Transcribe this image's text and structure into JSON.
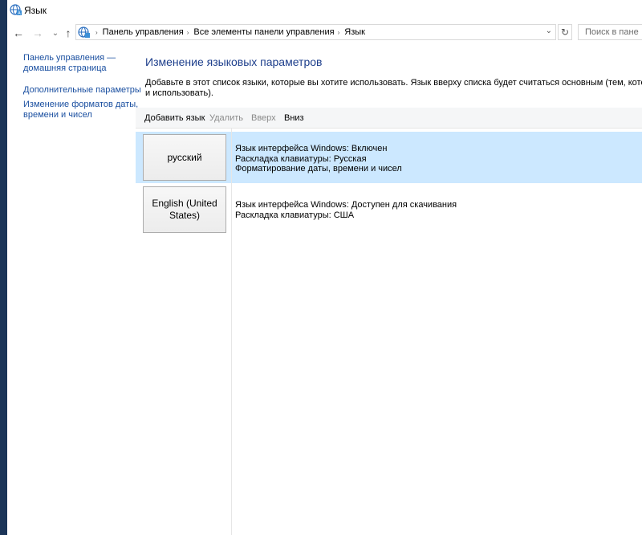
{
  "window": {
    "title": "Язык"
  },
  "nav": {
    "back": "←",
    "forward": "→",
    "recent": "⌄",
    "up": "↑",
    "breadcrumbs": [
      "Панель управления",
      "Все элементы панели управления",
      "Язык"
    ],
    "breadcrumb_sep": "›",
    "dropdown": "⌄",
    "refresh": "↻",
    "search_placeholder": "Поиск в пане"
  },
  "sidebar": {
    "home_line1": "Панель управления —",
    "home_line2": "домашняя страница",
    "advanced": "Дополнительные параметры",
    "formats_line1": "Изменение форматов даты,",
    "formats_line2": "времени и чисел"
  },
  "main": {
    "title": "Изменение языковых параметров",
    "desc_line1": "Добавьте в этот список языки, которые вы хотите использовать. Язык вверху списка будет считаться основным (тем, который вы хотите",
    "desc_line2": "и использовать)."
  },
  "toolbar": {
    "add": "Добавить язык",
    "remove": "Удалить",
    "up": "Вверх",
    "down": "Вниз"
  },
  "languages": [
    {
      "name_line1": "русский",
      "name_line2": "",
      "info1": "Язык интерфейса Windows: Включен",
      "info2": "Раскладка клавиатуры: Русская",
      "info3": "Форматирование даты, времени и чисел"
    },
    {
      "name_line1": "English (United",
      "name_line2": "States)",
      "info1": "Язык интерфейса Windows: Доступен для скачивания",
      "info2": "Раскладка клавиатуры: США",
      "info3": ""
    }
  ],
  "colors": {
    "selection": "#cce8ff",
    "link": "#1a4fa0",
    "heading": "#1e3f8c"
  }
}
